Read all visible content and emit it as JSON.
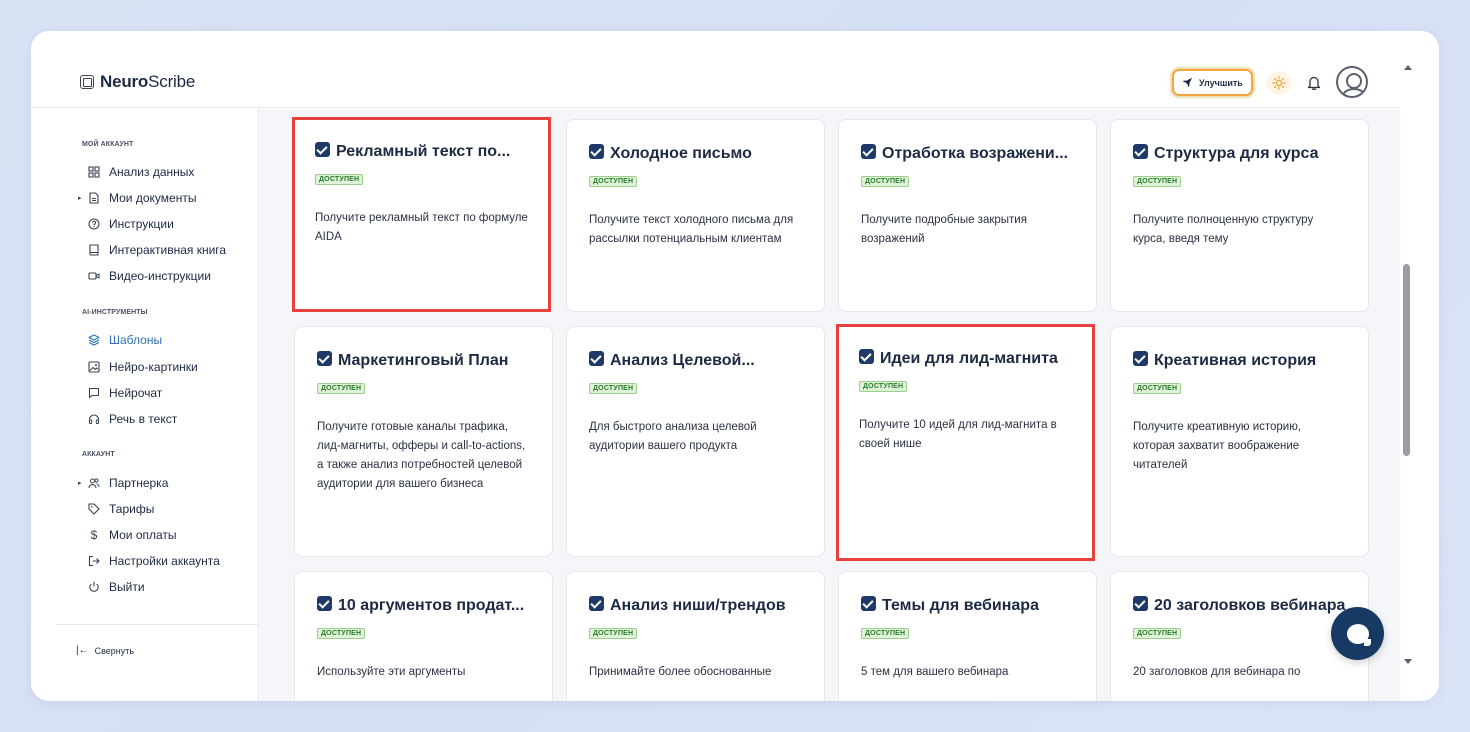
{
  "header": {
    "logo_bold": "Neuro",
    "logo_rest": "Scribe",
    "upgrade_label": "Улучшить",
    "icons": [
      "rocket-icon",
      "sun-icon",
      "bell-icon",
      "avatar"
    ]
  },
  "sidebar": {
    "sections": [
      {
        "title": "мой аккаунт",
        "items": [
          {
            "label": "Анализ данных",
            "icon": "grid-icon",
            "caret": false,
            "active": false
          },
          {
            "label": "Мои документы",
            "icon": "document-icon",
            "caret": true,
            "active": false
          },
          {
            "label": "Инструкции",
            "icon": "question-icon",
            "caret": false,
            "active": false
          },
          {
            "label": "Интерактивная книга",
            "icon": "book-icon",
            "caret": false,
            "active": false
          },
          {
            "label": "Видео-инструкции",
            "icon": "video-icon",
            "caret": false,
            "active": false
          }
        ]
      },
      {
        "title": "ai-инструменты",
        "items": [
          {
            "label": "Шаблоны",
            "icon": "layers-icon",
            "caret": false,
            "active": true
          },
          {
            "label": "Нейро-картинки",
            "icon": "image-icon",
            "caret": false,
            "active": false
          },
          {
            "label": "Нейрочат",
            "icon": "chat-icon",
            "caret": false,
            "active": false
          },
          {
            "label": "Речь в текст",
            "icon": "headphones-icon",
            "caret": false,
            "active": false
          }
        ]
      },
      {
        "title": "аккаунт",
        "items": [
          {
            "label": "Партнерка",
            "icon": "users-icon",
            "caret": true,
            "active": false
          },
          {
            "label": "Тарифы",
            "icon": "tag-icon",
            "caret": false,
            "active": false
          },
          {
            "label": "Мои оплаты",
            "icon": "dollar-icon",
            "caret": false,
            "active": false
          },
          {
            "label": "Настройки аккаунта",
            "icon": "login-icon",
            "caret": false,
            "active": false
          },
          {
            "label": "Выйти",
            "icon": "power-icon",
            "caret": false,
            "active": false
          }
        ]
      }
    ],
    "collapse_label": "Свернуть"
  },
  "cards": [
    {
      "title": "Рекламный текст по...",
      "badge": "доступен",
      "desc": "Получите рекламный текст по формуле AIDA",
      "highlight": true
    },
    {
      "title": "Холодное письмо",
      "badge": "доступен",
      "desc": "Получите текст холодного письма для рассылки потенциальным клиентам",
      "highlight": false
    },
    {
      "title": "Отработка возражени...",
      "badge": "доступен",
      "desc": "Получите подробные закрытия возражений",
      "highlight": false
    },
    {
      "title": "Структура для курса",
      "badge": "доступен",
      "desc": "Получите полноценную структуру курса, введя тему",
      "highlight": false
    },
    {
      "title": "Маркетинговый План",
      "badge": "доступен",
      "desc": "Получите готовые каналы трафика, лид-магниты, офферы и call-to-actions, а также анализ потребностей целевой аудитории для вашего бизнеса",
      "highlight": false
    },
    {
      "title": "Анализ Целевой...",
      "badge": "доступен",
      "desc": "Для быстрого анализа целевой аудитории вашего продукта",
      "highlight": false
    },
    {
      "title": "Идеи для лид-магнита",
      "badge": "доступен",
      "desc": "Получите 10 идей для лид-магнита в своей нише",
      "highlight": true
    },
    {
      "title": "Креативная история",
      "badge": "доступен",
      "desc": "Получите креативную историю, которая захватит воображение читателей",
      "highlight": false
    },
    {
      "title": "10 аргументов продат...",
      "badge": "доступен",
      "desc": "Используйте эти аргументы",
      "highlight": false
    },
    {
      "title": "Анализ ниши/трендов",
      "badge": "доступен",
      "desc": "Принимайте более обоснованные",
      "highlight": false
    },
    {
      "title": "Темы для вебинара",
      "badge": "доступен",
      "desc": "5 тем для вашего вебинара",
      "highlight": false
    },
    {
      "title": "20 заголовков вебинара",
      "badge": "доступен",
      "desc": "20 заголовков для вебинара по",
      "highlight": false
    }
  ]
}
